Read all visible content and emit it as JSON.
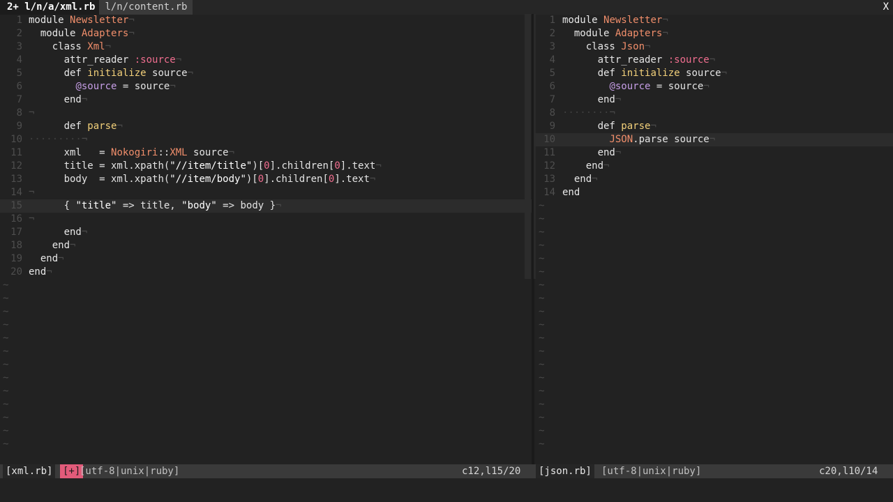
{
  "tabline": {
    "active_tab": "2+ l/n/a/xml.rb",
    "inactive_tab": "l/n/content.rb",
    "close": "X"
  },
  "left_pane": {
    "lines": [
      {
        "n": "1",
        "code": [
          [
            "kw",
            "module "
          ],
          [
            "const",
            "Newsletter"
          ],
          [
            "eol",
            "¬"
          ]
        ]
      },
      {
        "n": "2",
        "code": [
          [
            "ind",
            "  "
          ],
          [
            "kw",
            "module "
          ],
          [
            "const",
            "Adapters"
          ],
          [
            "eol",
            "¬"
          ]
        ]
      },
      {
        "n": "3",
        "code": [
          [
            "ind",
            "    "
          ],
          [
            "kw",
            "class "
          ],
          [
            "const",
            "Xml"
          ],
          [
            "eol",
            "¬"
          ]
        ]
      },
      {
        "n": "4",
        "code": [
          [
            "ind",
            "      "
          ],
          [
            "plain",
            "attr_reader "
          ],
          [
            "sym",
            ":source"
          ],
          [
            "eol",
            "¬"
          ]
        ]
      },
      {
        "n": "5",
        "code": [
          [
            "ind",
            "      "
          ],
          [
            "def",
            "def "
          ],
          [
            "fn",
            "initialize"
          ],
          [
            "plain",
            " source"
          ],
          [
            "eol",
            "¬"
          ]
        ]
      },
      {
        "n": "6",
        "code": [
          [
            "ind",
            "        "
          ],
          [
            "ivar",
            "@source"
          ],
          [
            "plain",
            " = source"
          ],
          [
            "eol",
            "¬"
          ]
        ]
      },
      {
        "n": "7",
        "code": [
          [
            "ind",
            "      "
          ],
          [
            "kw",
            "end"
          ],
          [
            "eol",
            "¬"
          ]
        ]
      },
      {
        "n": "8",
        "code": [
          [
            "eol",
            "¬"
          ]
        ]
      },
      {
        "n": "9",
        "code": [
          [
            "ind",
            "      "
          ],
          [
            "def",
            "def "
          ],
          [
            "fn",
            "parse"
          ],
          [
            "eol",
            "¬"
          ]
        ]
      },
      {
        "n": "10",
        "code": [
          [
            "ind",
            "·········"
          ],
          [
            "eol",
            "¬"
          ]
        ]
      },
      {
        "n": "11",
        "code": [
          [
            "ind",
            "      "
          ],
          [
            "plain",
            "xml   = "
          ],
          [
            "const",
            "Nokogiri"
          ],
          [
            "plain",
            "::"
          ],
          [
            "const",
            "XML"
          ],
          [
            "plain",
            " source"
          ],
          [
            "eol",
            "¬"
          ]
        ]
      },
      {
        "n": "12",
        "code": [
          [
            "ind",
            "      "
          ],
          [
            "plain",
            "title = xml.xpath("
          ],
          [
            "str",
            "\"//item/title\""
          ],
          [
            "plain",
            ")["
          ],
          [
            "num",
            "0"
          ],
          [
            "plain",
            "].children["
          ],
          [
            "num",
            "0"
          ],
          [
            "plain",
            "].text"
          ],
          [
            "eol",
            "¬"
          ]
        ]
      },
      {
        "n": "13",
        "code": [
          [
            "ind",
            "      "
          ],
          [
            "plain",
            "body  = xml.xpath("
          ],
          [
            "str",
            "\"//item/body\""
          ],
          [
            "plain",
            ")["
          ],
          [
            "num",
            "0"
          ],
          [
            "plain",
            "].children["
          ],
          [
            "num",
            "0"
          ],
          [
            "plain",
            "].text"
          ],
          [
            "eol",
            "¬"
          ]
        ]
      },
      {
        "n": "14",
        "code": [
          [
            "eol",
            "¬"
          ]
        ]
      },
      {
        "n": "15",
        "current": true,
        "code": [
          [
            "ind",
            "      "
          ],
          [
            "plain",
            "{ "
          ],
          [
            "str",
            "\"title\""
          ],
          [
            "plain",
            " => title, "
          ],
          [
            "str",
            "\"body\""
          ],
          [
            "plain",
            " => body }"
          ],
          [
            "eol",
            "¬"
          ]
        ]
      },
      {
        "n": "16",
        "code": [
          [
            "eol",
            "¬"
          ]
        ]
      },
      {
        "n": "17",
        "code": [
          [
            "ind",
            "      "
          ],
          [
            "kw",
            "end"
          ],
          [
            "eol",
            "¬"
          ]
        ]
      },
      {
        "n": "18",
        "code": [
          [
            "ind",
            "    "
          ],
          [
            "kw",
            "end"
          ],
          [
            "eol",
            "¬"
          ]
        ]
      },
      {
        "n": "19",
        "code": [
          [
            "ind",
            "  "
          ],
          [
            "kw",
            "end"
          ],
          [
            "eol",
            "¬"
          ]
        ]
      },
      {
        "n": "20",
        "code": [
          [
            "kw",
            "end"
          ],
          [
            "eol",
            "¬"
          ]
        ]
      }
    ],
    "tilde_count": 13
  },
  "right_pane": {
    "lines": [
      {
        "n": "1",
        "code": [
          [
            "kw",
            "module "
          ],
          [
            "const",
            "Newsletter"
          ],
          [
            "eol",
            "¬"
          ]
        ]
      },
      {
        "n": "2",
        "code": [
          [
            "ind",
            "  "
          ],
          [
            "kw",
            "module "
          ],
          [
            "const",
            "Adapters"
          ],
          [
            "eol",
            "¬"
          ]
        ]
      },
      {
        "n": "3",
        "code": [
          [
            "ind",
            "    "
          ],
          [
            "kw",
            "class "
          ],
          [
            "const",
            "Json"
          ],
          [
            "eol",
            "¬"
          ]
        ]
      },
      {
        "n": "4",
        "code": [
          [
            "ind",
            "      "
          ],
          [
            "plain",
            "attr_reader "
          ],
          [
            "sym",
            ":source"
          ],
          [
            "eol",
            "¬"
          ]
        ]
      },
      {
        "n": "5",
        "code": [
          [
            "ind",
            "      "
          ],
          [
            "def",
            "def "
          ],
          [
            "fn",
            "initialize"
          ],
          [
            "plain",
            " source"
          ],
          [
            "eol",
            "¬"
          ]
        ]
      },
      {
        "n": "6",
        "code": [
          [
            "ind",
            "        "
          ],
          [
            "ivar",
            "@source"
          ],
          [
            "plain",
            " = source"
          ],
          [
            "eol",
            "¬"
          ]
        ]
      },
      {
        "n": "7",
        "code": [
          [
            "ind",
            "      "
          ],
          [
            "kw",
            "end"
          ],
          [
            "eol",
            "¬"
          ]
        ]
      },
      {
        "n": "8",
        "code": [
          [
            "ind",
            "········"
          ],
          [
            "eol",
            "¬"
          ]
        ]
      },
      {
        "n": "9",
        "code": [
          [
            "ind",
            "      "
          ],
          [
            "def",
            "def "
          ],
          [
            "fn",
            "parse"
          ],
          [
            "eol",
            "¬"
          ]
        ]
      },
      {
        "n": "10",
        "current": true,
        "code": [
          [
            "ind",
            "        "
          ],
          [
            "const",
            "JSON"
          ],
          [
            "plain",
            ".parse source"
          ],
          [
            "eol",
            "¬"
          ]
        ]
      },
      {
        "n": "11",
        "code": [
          [
            "ind",
            "      "
          ],
          [
            "kw",
            "end"
          ],
          [
            "eol",
            "¬"
          ]
        ]
      },
      {
        "n": "12",
        "code": [
          [
            "ind",
            "    "
          ],
          [
            "kw",
            "end"
          ],
          [
            "eol",
            "¬"
          ]
        ]
      },
      {
        "n": "13",
        "code": [
          [
            "ind",
            "  "
          ],
          [
            "kw",
            "end"
          ],
          [
            "eol",
            "¬"
          ]
        ]
      },
      {
        "n": "14",
        "code": [
          [
            "kw",
            "end"
          ]
        ]
      }
    ],
    "tilde_count": 19
  },
  "status": {
    "left_file": "[xml.rb]",
    "left_modified": "[+]",
    "left_encoding": "[utf-8|unix|ruby]",
    "left_position": "c12,l15/20",
    "right_file": "[json.rb]",
    "right_encoding": "[utf-8|unix|ruby]",
    "right_position": "c20,l10/14"
  },
  "colors": {
    "background": "#222222",
    "constant": "#f08e6b",
    "function": "#f2d07a",
    "symbol": "#f06e8f",
    "ivar": "#c69ee6",
    "modified_badge": "#e25b7a"
  }
}
